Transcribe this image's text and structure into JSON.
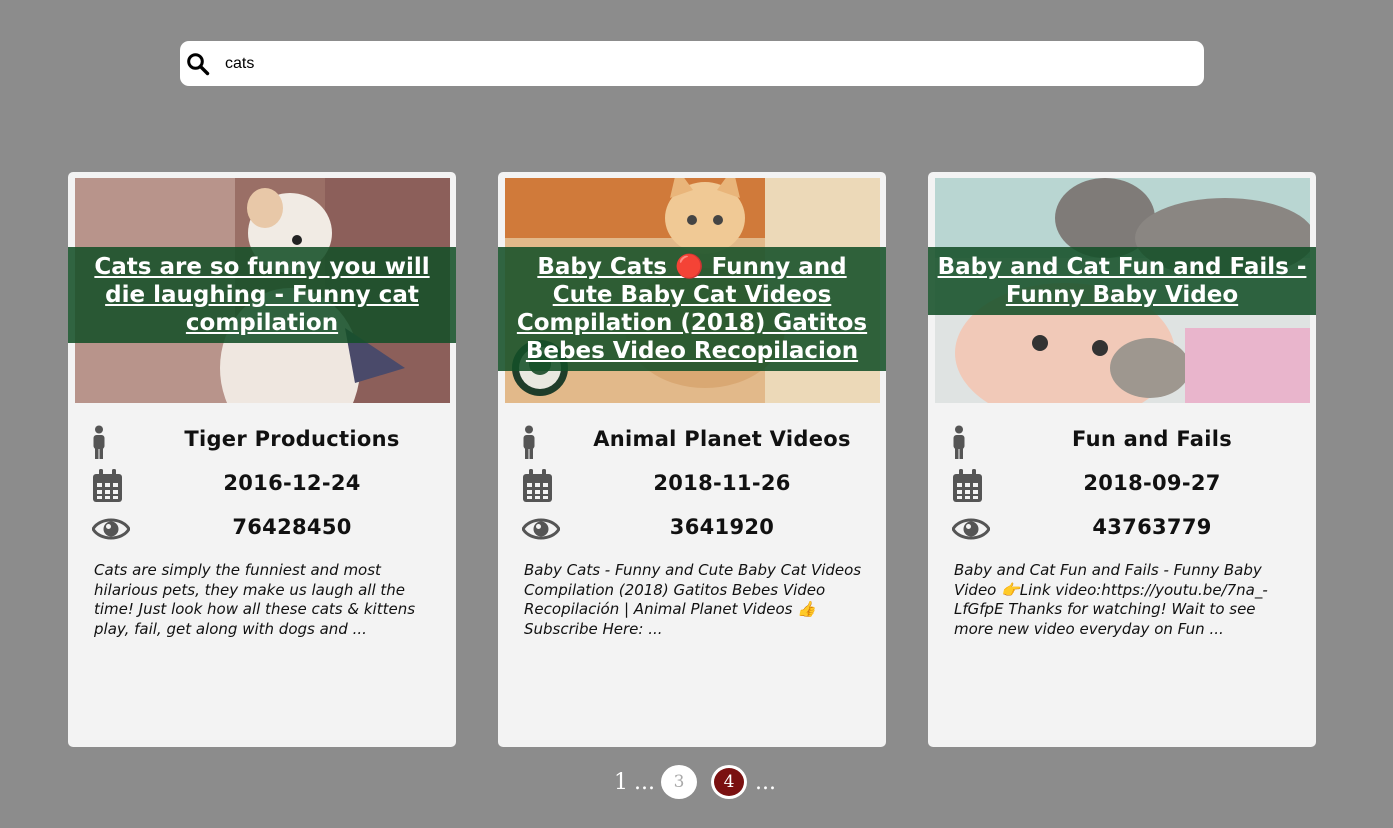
{
  "search": {
    "value": "cats"
  },
  "results": [
    {
      "title": "Cats are so funny you will die laughing - Funny cat compilation",
      "channel": "Tiger Productions",
      "date": "2016-12-24",
      "views": "76428450",
      "description": "Cats are simply the funniest and most hilarious pets, they make us laugh all the time! Just look how all these cats & kittens play, fail, get along with dogs and ..."
    },
    {
      "title": "Baby Cats 🔴 Funny and Cute Baby Cat Videos Compilation (2018) Gatitos Bebes Video Recopilacion",
      "channel": "Animal Planet Videos",
      "date": "2018-11-26",
      "views": "3641920",
      "description": "Baby Cats - Funny and Cute Baby Cat Videos Compilation (2018) Gatitos Bebes Video Recopilación | Animal Planet Videos 👍 Subscribe Here: ..."
    },
    {
      "title": "Baby and Cat Fun and Fails - Funny Baby Video",
      "channel": "Fun and Fails",
      "date": "2018-09-27",
      "views": "43763779",
      "description": "Baby and Cat Fun and Fails - Funny Baby Video 👉Link video:https://youtu.be/7na_-LfGfpE Thanks for watching! Wait to see more new video everyday on Fun ..."
    }
  ],
  "pagination": {
    "first": "1",
    "ellipsis": "...",
    "pages": [
      "3",
      "4"
    ],
    "current": "4"
  },
  "icons": {
    "search": "search-icon",
    "channel": "person-icon",
    "date": "calendar-icon",
    "views": "eye-icon"
  },
  "colors": {
    "background": "#8c8c8c",
    "card": "#f3f3f3",
    "title_band": "#145028",
    "active_page": "#7a1010"
  }
}
